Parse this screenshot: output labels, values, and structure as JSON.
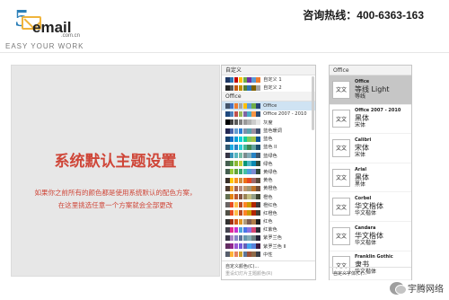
{
  "header": {
    "logo_mark": "5",
    "logo_brand": "email",
    "logo_domain": ".com.cn",
    "logo_tagline": "EASY YOUR WORK",
    "hotline_label": "咨询热线：",
    "hotline_number": "400-6363-163"
  },
  "slide": {
    "title": "系统默认主题设置",
    "body": "如果你之前所有的颜色都是使用系统默认的配色方案，在这里挑选任意一个方案就会全部更改"
  },
  "color_panel": {
    "custom_header": "自定义",
    "office_header": "Office",
    "custom_items": [
      {
        "label": "自定义 1",
        "colors": [
          "#1f3864",
          "#2e75b6",
          "#c00000",
          "#ffc000",
          "#70ad47",
          "#7030a0",
          "#5b9bd5",
          "#ed7d31"
        ]
      },
      {
        "label": "自定义 2",
        "colors": [
          "#262626",
          "#595959",
          "#c55a11",
          "#bf9000",
          "#548235",
          "#2e75b6",
          "#7f6000",
          "#a5a5a5"
        ]
      }
    ],
    "office_items": [
      {
        "label": "Office",
        "colors": [
          "#44546a",
          "#4472c4",
          "#ed7d31",
          "#a5a5a5",
          "#ffc000",
          "#5b9bd5",
          "#70ad47",
          "#264478"
        ],
        "selected": true
      },
      {
        "label": "Office 2007 - 2010",
        "colors": [
          "#1f497d",
          "#4f81bd",
          "#c0504d",
          "#9bbb59",
          "#8064a2",
          "#4bacc6",
          "#f79646",
          "#2c4d75"
        ]
      },
      {
        "label": "灰度",
        "colors": [
          "#000000",
          "#404040",
          "#595959",
          "#7f7f7f",
          "#999999",
          "#b2b2b2",
          "#cccccc",
          "#e5e5e5"
        ]
      },
      {
        "label": "蓝色暖调",
        "colors": [
          "#242852",
          "#4a66ac",
          "#629dd1",
          "#297fd5",
          "#7f8fa9",
          "#5aa2ae",
          "#9d90a0",
          "#3d4e6e"
        ]
      },
      {
        "label": "蓝色",
        "colors": [
          "#17406d",
          "#0f6fc6",
          "#009dd9",
          "#0bd0d9",
          "#10cf9b",
          "#7cca62",
          "#a5c249",
          "#0b5394"
        ]
      },
      {
        "label": "蓝色 II",
        "colors": [
          "#335b74",
          "#1cade4",
          "#2683c6",
          "#27ced7",
          "#42ba97",
          "#3e8853",
          "#62a39f",
          "#1b4e6b"
        ]
      },
      {
        "label": "蓝绿色",
        "colors": [
          "#373545",
          "#3494ba",
          "#58b6c0",
          "#75bda7",
          "#7a8c8e",
          "#84acb6",
          "#2683c6",
          "#40566b"
        ]
      },
      {
        "label": "绿色",
        "colors": [
          "#455f51",
          "#549e39",
          "#8ab833",
          "#c0cf3a",
          "#029676",
          "#4ab5c4",
          "#0989b1",
          "#2e4b3d"
        ]
      },
      {
        "label": "黄绿色",
        "colors": [
          "#455f51",
          "#99cb38",
          "#63a537",
          "#37a76f",
          "#44c1a3",
          "#4e9ddb",
          "#7d8bd2",
          "#304a3c"
        ]
      },
      {
        "label": "黄色",
        "colors": [
          "#39302a",
          "#ffca08",
          "#f8931d",
          "#ce8d3e",
          "#ec7016",
          "#e64823",
          "#9c6a6a",
          "#5c4b3c"
        ]
      },
      {
        "label": "黄橙色",
        "colors": [
          "#4e3b30",
          "#f0a22e",
          "#a5644e",
          "#b58b80",
          "#c3986d",
          "#a19574",
          "#c17529",
          "#6f4e3a"
        ]
      },
      {
        "label": "橙色",
        "colors": [
          "#637052",
          "#e48312",
          "#bd582c",
          "#865640",
          "#9b8357",
          "#c2bc80",
          "#94a088",
          "#3e4531"
        ]
      },
      {
        "label": "橙红色",
        "colors": [
          "#696464",
          "#e84c22",
          "#ffbd47",
          "#b64926",
          "#ff8427",
          "#cc9900",
          "#b22600",
          "#3f3a3a"
        ]
      },
      {
        "label": "红橙色",
        "colors": [
          "#505046",
          "#e84c22",
          "#ffbd47",
          "#b64926",
          "#ff8427",
          "#cc9900",
          "#b22600",
          "#3f3f34"
        ]
      },
      {
        "label": "红色",
        "colors": [
          "#323232",
          "#a5300f",
          "#d55816",
          "#e19825",
          "#b19c7d",
          "#7f5f52",
          "#b27d49",
          "#1f1f1f"
        ]
      },
      {
        "label": "红紫色",
        "colors": [
          "#454551",
          "#e32d91",
          "#c830cc",
          "#4ea6dc",
          "#4775e7",
          "#8971e1",
          "#d54773",
          "#2d2d37"
        ]
      },
      {
        "label": "紫罗兰色",
        "colors": [
          "#373545",
          "#ad84c6",
          "#8784c7",
          "#5d739a",
          "#6997af",
          "#84acb6",
          "#6f8183",
          "#26243a"
        ]
      },
      {
        "label": "紫罗兰色 II",
        "colors": [
          "#632e62",
          "#92278f",
          "#9b57d3",
          "#755dd9",
          "#665eb8",
          "#45a5ed",
          "#5982db",
          "#3e1a3d"
        ]
      },
      {
        "label": "中性",
        "colors": [
          "#575f6d",
          "#ffb237",
          "#e5805e",
          "#cca22e",
          "#5e7799",
          "#9c5238",
          "#8e6b49",
          "#3a3f48"
        ]
      }
    ],
    "footer_customize": "自定义颜色(C)...",
    "footer_reset": "重设幻灯片主题颜色(R)"
  },
  "font_panel": {
    "header": "Office",
    "preview_glyph": "文文",
    "items": [
      {
        "name": "Office",
        "heading": "等线 Light",
        "body": "等线",
        "selected": true
      },
      {
        "name": "Office 2007 - 2010",
        "heading": "黑体",
        "body": "宋体"
      },
      {
        "name": "Calibri",
        "heading": "宋体",
        "body": "宋体"
      },
      {
        "name": "Arial",
        "heading": "黑体",
        "body": "黑体"
      },
      {
        "name": "Corbel",
        "heading": "华文楷体",
        "body": "华文楷体"
      },
      {
        "name": "Candara",
        "heading": "华文楷体",
        "body": "华文楷体"
      },
      {
        "name": "Franklin Gothic",
        "heading": "隶书",
        "body": "华文楷体"
      }
    ],
    "footer_customize": "自定义字体(C)..."
  },
  "watermark": {
    "text": "宇腾网络"
  }
}
